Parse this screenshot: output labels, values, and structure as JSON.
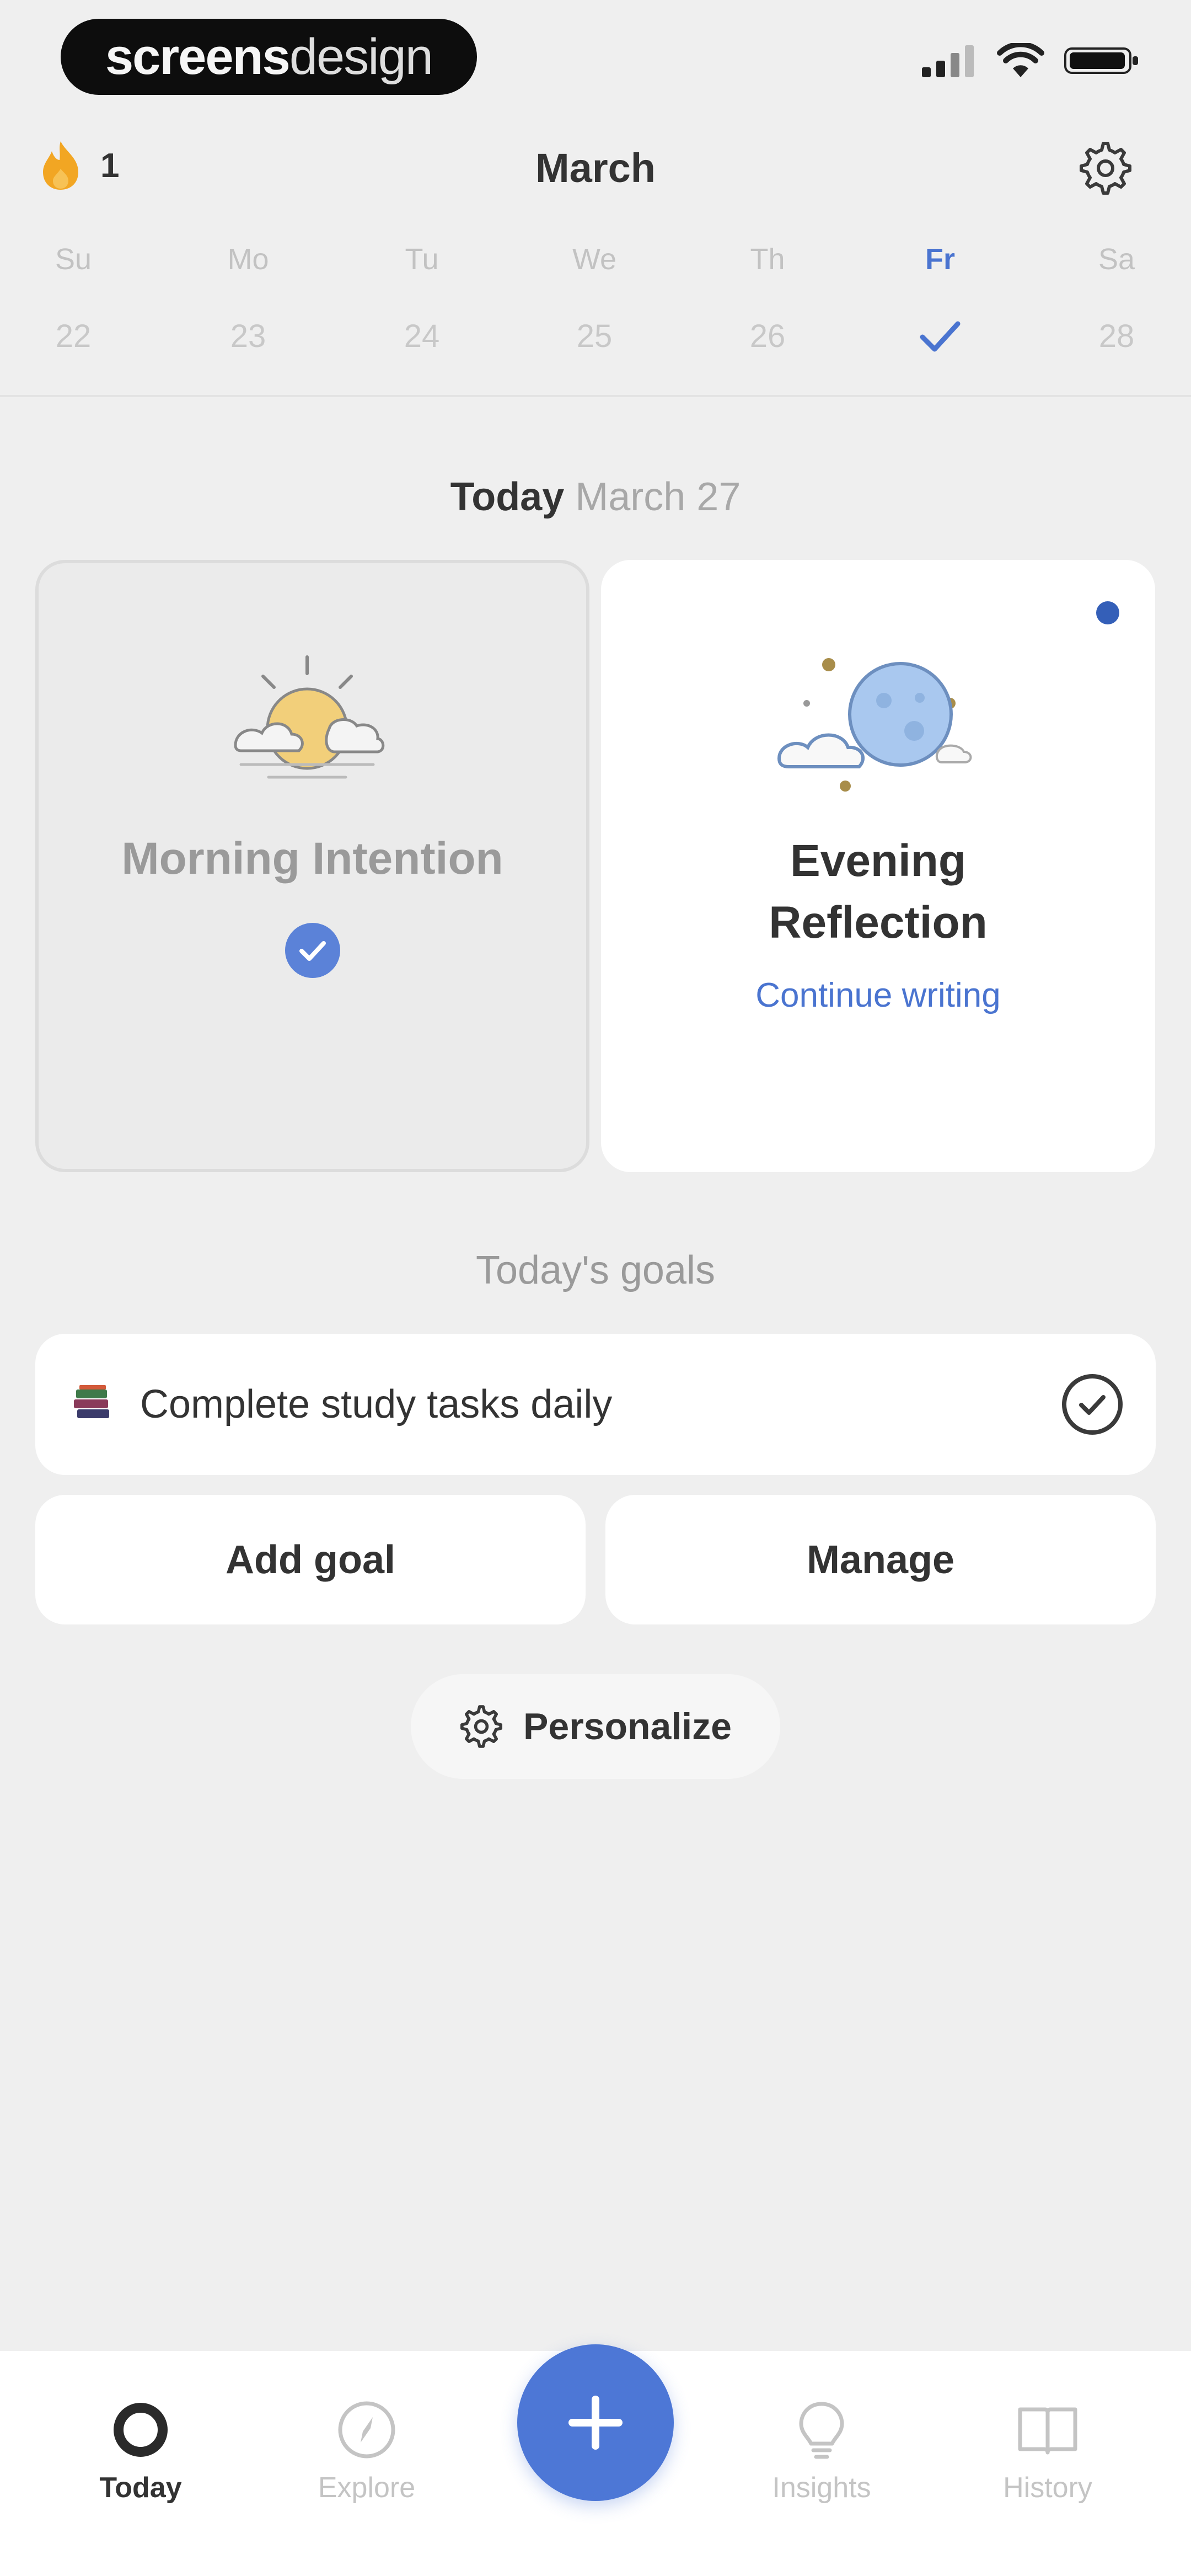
{
  "status_bar": {
    "logo_bold": "screens",
    "logo_light": "design",
    "icons": [
      "cellular-signal-icon",
      "wifi-icon",
      "battery-icon"
    ]
  },
  "header": {
    "streak_count": "1",
    "streak_icon": "flame-icon",
    "month": "March",
    "settings_icon": "gear-icon"
  },
  "week": {
    "days": [
      {
        "name": "Su",
        "num": "22"
      },
      {
        "name": "Mo",
        "num": "23"
      },
      {
        "name": "Tu",
        "num": "24"
      },
      {
        "name": "We",
        "num": "25"
      },
      {
        "name": "Th",
        "num": "26"
      },
      {
        "name": "Fr",
        "num": "",
        "completed": true
      },
      {
        "name": "Sa",
        "num": "28"
      }
    ],
    "active_index": 5
  },
  "today": {
    "label": "Today",
    "date": "March 27"
  },
  "cards": {
    "morning": {
      "title": "Morning Intention",
      "completed": true,
      "icon": "sun-cloud-icon"
    },
    "evening": {
      "title": "Evening Reflection",
      "link": "Continue writing",
      "icon": "moon-cloud-icon",
      "unread": true
    }
  },
  "goals": {
    "heading": "Today's goals",
    "items": [
      {
        "label": "Complete study tasks daily",
        "icon": "books-icon",
        "done": true
      }
    ],
    "add_label": "Add goal",
    "manage_label": "Manage"
  },
  "personalize": {
    "label": "Personalize",
    "icon": "gear-icon"
  },
  "tabbar": {
    "tabs": [
      {
        "label": "Today",
        "icon": "ring-icon",
        "active": true
      },
      {
        "label": "Explore",
        "icon": "compass-icon",
        "active": false
      },
      {
        "label": "Insights",
        "icon": "lightbulb-icon",
        "active": false
      },
      {
        "label": "History",
        "icon": "book-icon",
        "active": false
      }
    ],
    "fab_icon": "plus-icon"
  },
  "colors": {
    "accent": "#4d77d6",
    "background": "#efefef",
    "card": "#ffffff",
    "streak": "#f2a623"
  }
}
